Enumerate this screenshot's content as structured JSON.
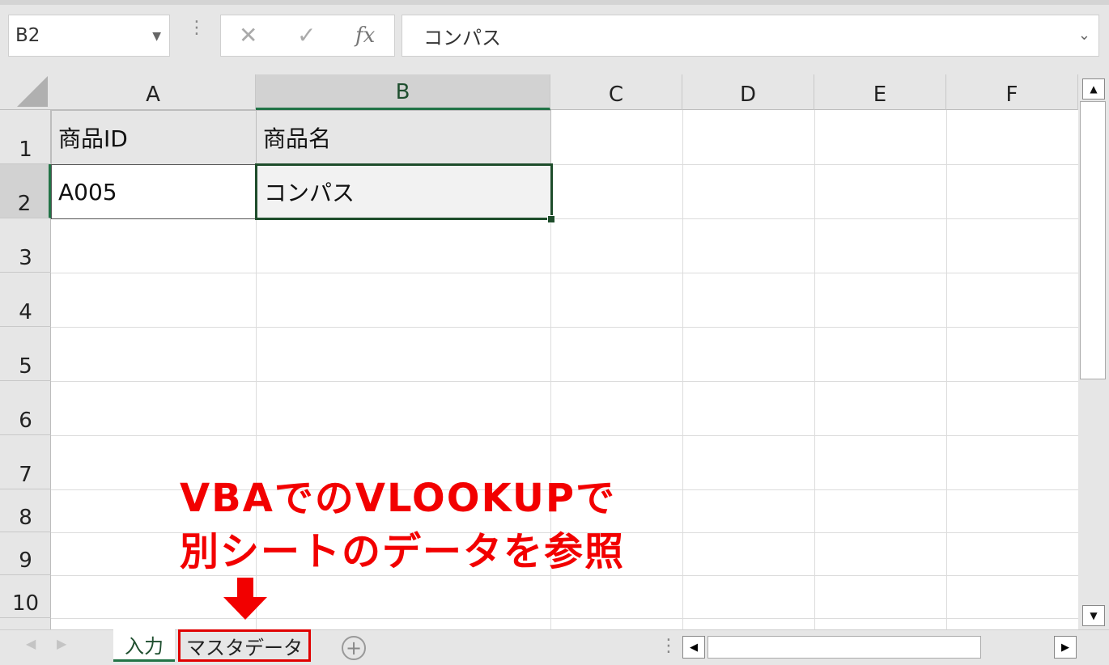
{
  "formula_bar": {
    "name_box": "B2",
    "cancel_icon": "✕",
    "enter_icon": "✓",
    "fx_label": "fx",
    "formula_value": "コンパス"
  },
  "columns": [
    "A",
    "B",
    "C",
    "D",
    "E",
    "F"
  ],
  "rows": [
    "1",
    "2",
    "3",
    "4",
    "5",
    "6",
    "7",
    "8",
    "9",
    "10"
  ],
  "cells": {
    "A1": "商品ID",
    "B1": "商品名",
    "A2": "A005",
    "B2": "コンパス"
  },
  "selected_cell": "B2",
  "sheet_tabs": [
    {
      "label": "入力",
      "active": true
    },
    {
      "label": "マスタデータ",
      "active": false,
      "highlighted": true
    }
  ],
  "annotation": {
    "line1": "VBAでのVLOOKUPで",
    "line2": "別シートのデータを参照",
    "color": "#f20000"
  },
  "colors": {
    "accent_green": "#217346",
    "highlight_red": "#e00000"
  }
}
